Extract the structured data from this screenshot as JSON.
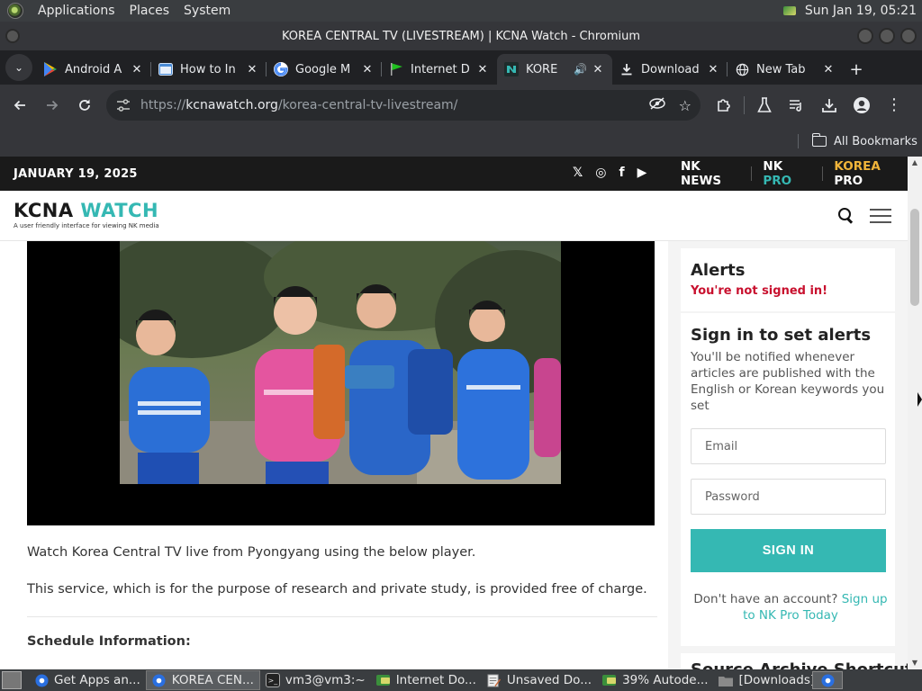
{
  "os_panel": {
    "menus": [
      "Applications",
      "Places",
      "System"
    ],
    "datetime": "Sun Jan 19, 05:21"
  },
  "window": {
    "title": "KOREA CENTRAL TV (LIVESTREAM) | KCNA Watch - Chromium"
  },
  "tabs": [
    {
      "title": "Android A",
      "icon": "play-store-icon",
      "active": false
    },
    {
      "title": "How to In",
      "icon": "browser-page-icon",
      "active": false
    },
    {
      "title": "Google M",
      "icon": "google-icon",
      "active": false
    },
    {
      "title": "Internet D",
      "icon": "green-flag-icon",
      "active": false
    },
    {
      "title": "KORE",
      "icon": "kcna-icon",
      "active": true
    },
    {
      "title": "Download",
      "icon": "download-icon",
      "active": false
    },
    {
      "title": "New Tab",
      "icon": "globe-icon",
      "active": false
    }
  ],
  "toolbar": {
    "url_scheme": "https://",
    "url_host": "kcnawatch.org",
    "url_path": "/korea-central-tv-livestream/"
  },
  "bookmarks": {
    "all_label": "All Bookmarks"
  },
  "site": {
    "date": "JANUARY 19, 2025",
    "social": [
      "𝕏",
      "◎",
      "f",
      "▶"
    ],
    "brands": {
      "nk_news": "NK NEWS",
      "nk_pro_a": "NK",
      "nk_pro_b": "PRO",
      "korea_pro_a": "KOREA",
      "korea_pro_b": "PRO"
    },
    "logo_a": "KCNA",
    "logo_b": "WATCH",
    "logo_tagline": "A user friendly interface for viewing NK media"
  },
  "article": {
    "paragraph_1": "Watch Korea Central TV live from Pyongyang using the below player.",
    "paragraph_2": "This service, which is for the purpose of research and private study, is provided free of charge.",
    "schedule_heading": "Schedule Information:"
  },
  "sidebar": {
    "alerts_title": "Alerts",
    "alerts_warning": "You're not signed in!",
    "signin_title": "Sign in to set alerts",
    "signin_desc": "You'll be notified whenever articles are published with the English or Korean keywords you set",
    "email_placeholder": "Email",
    "password_placeholder": "Password",
    "signin_button": "SIGN IN",
    "signup_prefix": "Don't have an account?",
    "signup_link": "Sign up to NK Pro Today",
    "next_card_title": "Source Archive Shortcuts"
  },
  "taskbar": [
    {
      "label": "Get Apps an...",
      "icon": "chrome-icon",
      "active": false
    },
    {
      "label": "KOREA CEN...",
      "icon": "chrome-icon",
      "active": true
    },
    {
      "label": "vm3@vm3:~",
      "icon": "terminal-icon",
      "active": false
    },
    {
      "label": "Internet Do...",
      "icon": "idm-icon",
      "active": false
    },
    {
      "label": "Unsaved Do...",
      "icon": "text-editor-icon",
      "active": false
    },
    {
      "label": "39% Autode...",
      "icon": "idm-icon",
      "active": false
    },
    {
      "label": "[Downloads]",
      "icon": "folder-icon",
      "active": false
    }
  ],
  "colors": {
    "accent_teal": "#35b8b3",
    "warning_red": "#c8102e",
    "korea_pro_gold": "#f0b43a"
  }
}
